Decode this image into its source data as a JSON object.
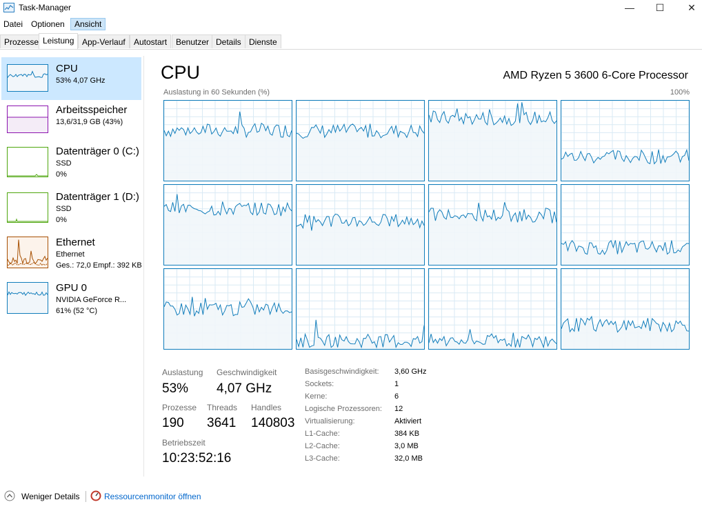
{
  "window": {
    "title": "Task-Manager",
    "minimize": "—",
    "maximize": "☐",
    "close": "✕"
  },
  "menu": [
    "Datei",
    "Optionen",
    "Ansicht"
  ],
  "tabs": [
    "Prozesse",
    "Leistung",
    "App-Verlauf",
    "Autostart",
    "Benutzer",
    "Details",
    "Dienste"
  ],
  "sidebar": [
    {
      "name": "CPU",
      "line2": "53% 4,07 GHz",
      "line3": "",
      "color": "#117dbb",
      "fill": "#f1f6fa"
    },
    {
      "name": "Arbeitsspeicher",
      "line2": "13,6/31,9 GB (43%)",
      "line3": "",
      "color": "#8b12ae",
      "fill": "#f4ecf7"
    },
    {
      "name": "Datenträger 0 (C:)",
      "line2": "SSD",
      "line3": "0%",
      "color": "#4da60c",
      "fill": "#ffffff"
    },
    {
      "name": "Datenträger 1 (D:)",
      "line2": "SSD",
      "line3": "0%",
      "color": "#4da60c",
      "fill": "#ffffff"
    },
    {
      "name": "Ethernet",
      "line2": "Ethernet",
      "line3": "Ges.: 72,0 Empf.: 392 KB",
      "color": "#a74f01",
      "fill": "#fcf3eb"
    },
    {
      "name": "GPU 0",
      "line2": "NVIDIA GeForce R...",
      "line3": "61% (52 °C)",
      "color": "#117dbb",
      "fill": "#f1f6fa"
    }
  ],
  "main": {
    "title": "CPU",
    "processor": "AMD Ryzen 5 3600 6-Core Processor",
    "graph_label": "Auslastung in 60 Sekunden (%)",
    "graph_max": "100%"
  },
  "colors": {
    "cpu_line": "#117dbb",
    "cpu_fill": "#f1f6fa",
    "grid": "#d9eaf4",
    "selected": "#cce8ff"
  },
  "core_levels": [
    63,
    62,
    78,
    30,
    70,
    55,
    62,
    22,
    50,
    10,
    10,
    30
  ],
  "stats": {
    "auslastung_label": "Auslastung",
    "auslastung": "53%",
    "speed_label": "Geschwindigkeit",
    "speed": "4,07 GHz",
    "processes_label": "Prozesse",
    "processes": "190",
    "threads_label": "Threads",
    "threads": "3641",
    "handles_label": "Handles",
    "handles": "140803",
    "uptime_label": "Betriebszeit",
    "uptime": "10:23:52:16"
  },
  "specs": [
    {
      "k": "Basisgeschwindigkeit:",
      "v": "3,60 GHz"
    },
    {
      "k": "Sockets:",
      "v": "1"
    },
    {
      "k": "Kerne:",
      "v": "6"
    },
    {
      "k": "Logische Prozessoren:",
      "v": "12"
    },
    {
      "k": "Virtualisierung:",
      "v": "Aktiviert"
    },
    {
      "k": "L1-Cache:",
      "v": "384 KB"
    },
    {
      "k": "L2-Cache:",
      "v": "3,0 MB"
    },
    {
      "k": "L3-Cache:",
      "v": "32,0 MB"
    }
  ],
  "footer": {
    "less": "Weniger Details",
    "monitor": "Ressourcenmonitor öffnen"
  }
}
